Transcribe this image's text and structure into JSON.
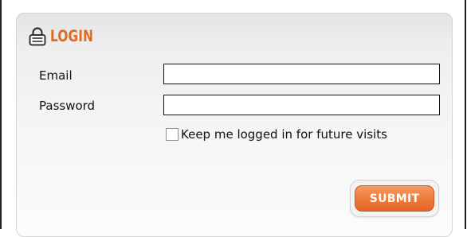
{
  "login": {
    "title": "LOGIN",
    "icon": "lock-icon",
    "accent_color": "#e06a1f",
    "email_label": "Email",
    "email_value": "",
    "password_label": "Password",
    "password_value": "",
    "remember_label": "Keep me logged in for future visits",
    "remember_checked": false,
    "submit_label": "SUBMIT",
    "submit_color": "#ef7c3a"
  }
}
